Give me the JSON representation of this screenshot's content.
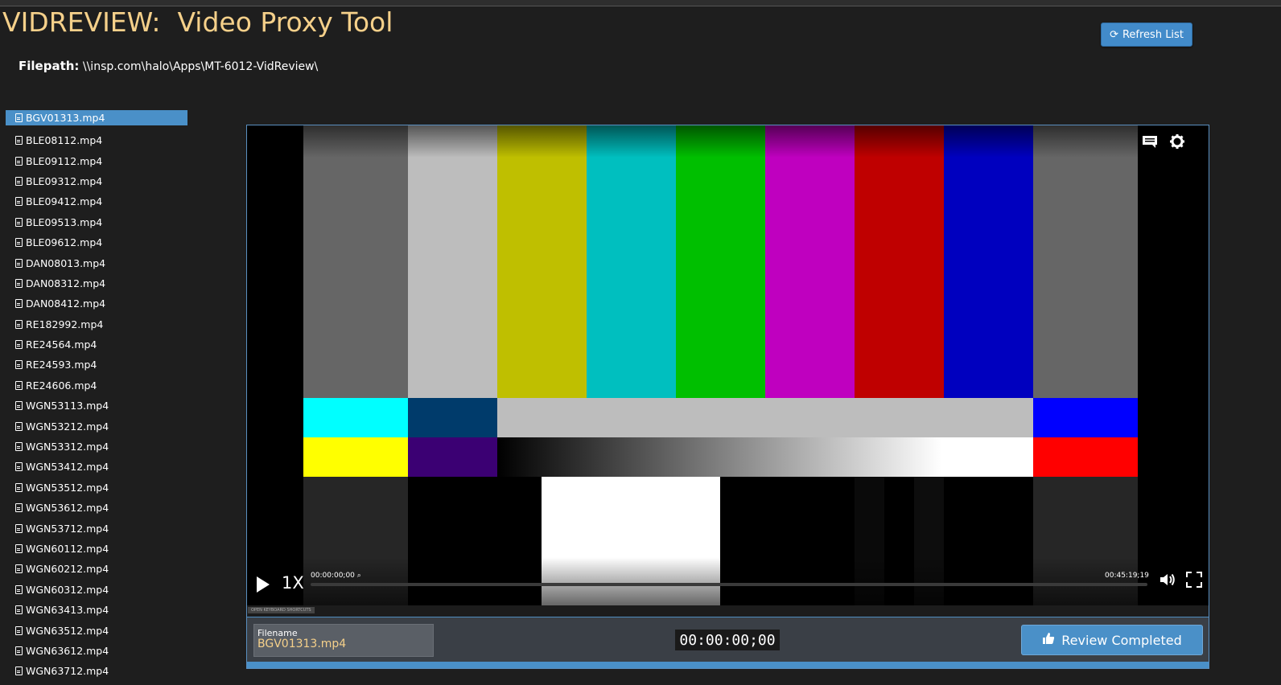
{
  "app": {
    "title": "VIDREVIEW:  Video Proxy Tool",
    "filepath_label": "Filepath:",
    "filepath_value": "\\\\insp.com\\halo\\Apps\\MT-6012-VidReview\\",
    "refresh_label": "Refresh List"
  },
  "files": [
    "BGV01313.mp4",
    "BLE08112.mp4",
    "BLE09112.mp4",
    "BLE09312.mp4",
    "BLE09412.mp4",
    "BLE09513.mp4",
    "BLE09612.mp4",
    "DAN08013.mp4",
    "DAN08312.mp4",
    "DAN08412.mp4",
    "RE182992.mp4",
    "RE24564.mp4",
    "RE24593.mp4",
    "RE24606.mp4",
    "WGN53113.mp4",
    "WGN53212.mp4",
    "WGN53312.mp4",
    "WGN53412.mp4",
    "WGN53512.mp4",
    "WGN53612.mp4",
    "WGN53712.mp4",
    "WGN60112.mp4",
    "WGN60212.mp4",
    "WGN60312.mp4",
    "WGN63413.mp4",
    "WGN63512.mp4",
    "WGN63612.mp4",
    "WGN63712.mp4"
  ],
  "selected_file": "BGV01313.mp4",
  "player": {
    "rate": "1X",
    "time_current": "00:00:00;00",
    "time_duration": "00:45:19;19",
    "progress": 0,
    "keyboard_shortcuts": "OPEN KEYBOARD SHORTCUTS"
  },
  "footer": {
    "filename_label": "Filename",
    "filename_value": "BGV01313.mp4",
    "timecode": "00:00:00;00",
    "review_label": "Review Completed"
  },
  "colors": {
    "accent": "#4a90c8",
    "title": "#f5d08a",
    "background": "#1e1e1e"
  }
}
